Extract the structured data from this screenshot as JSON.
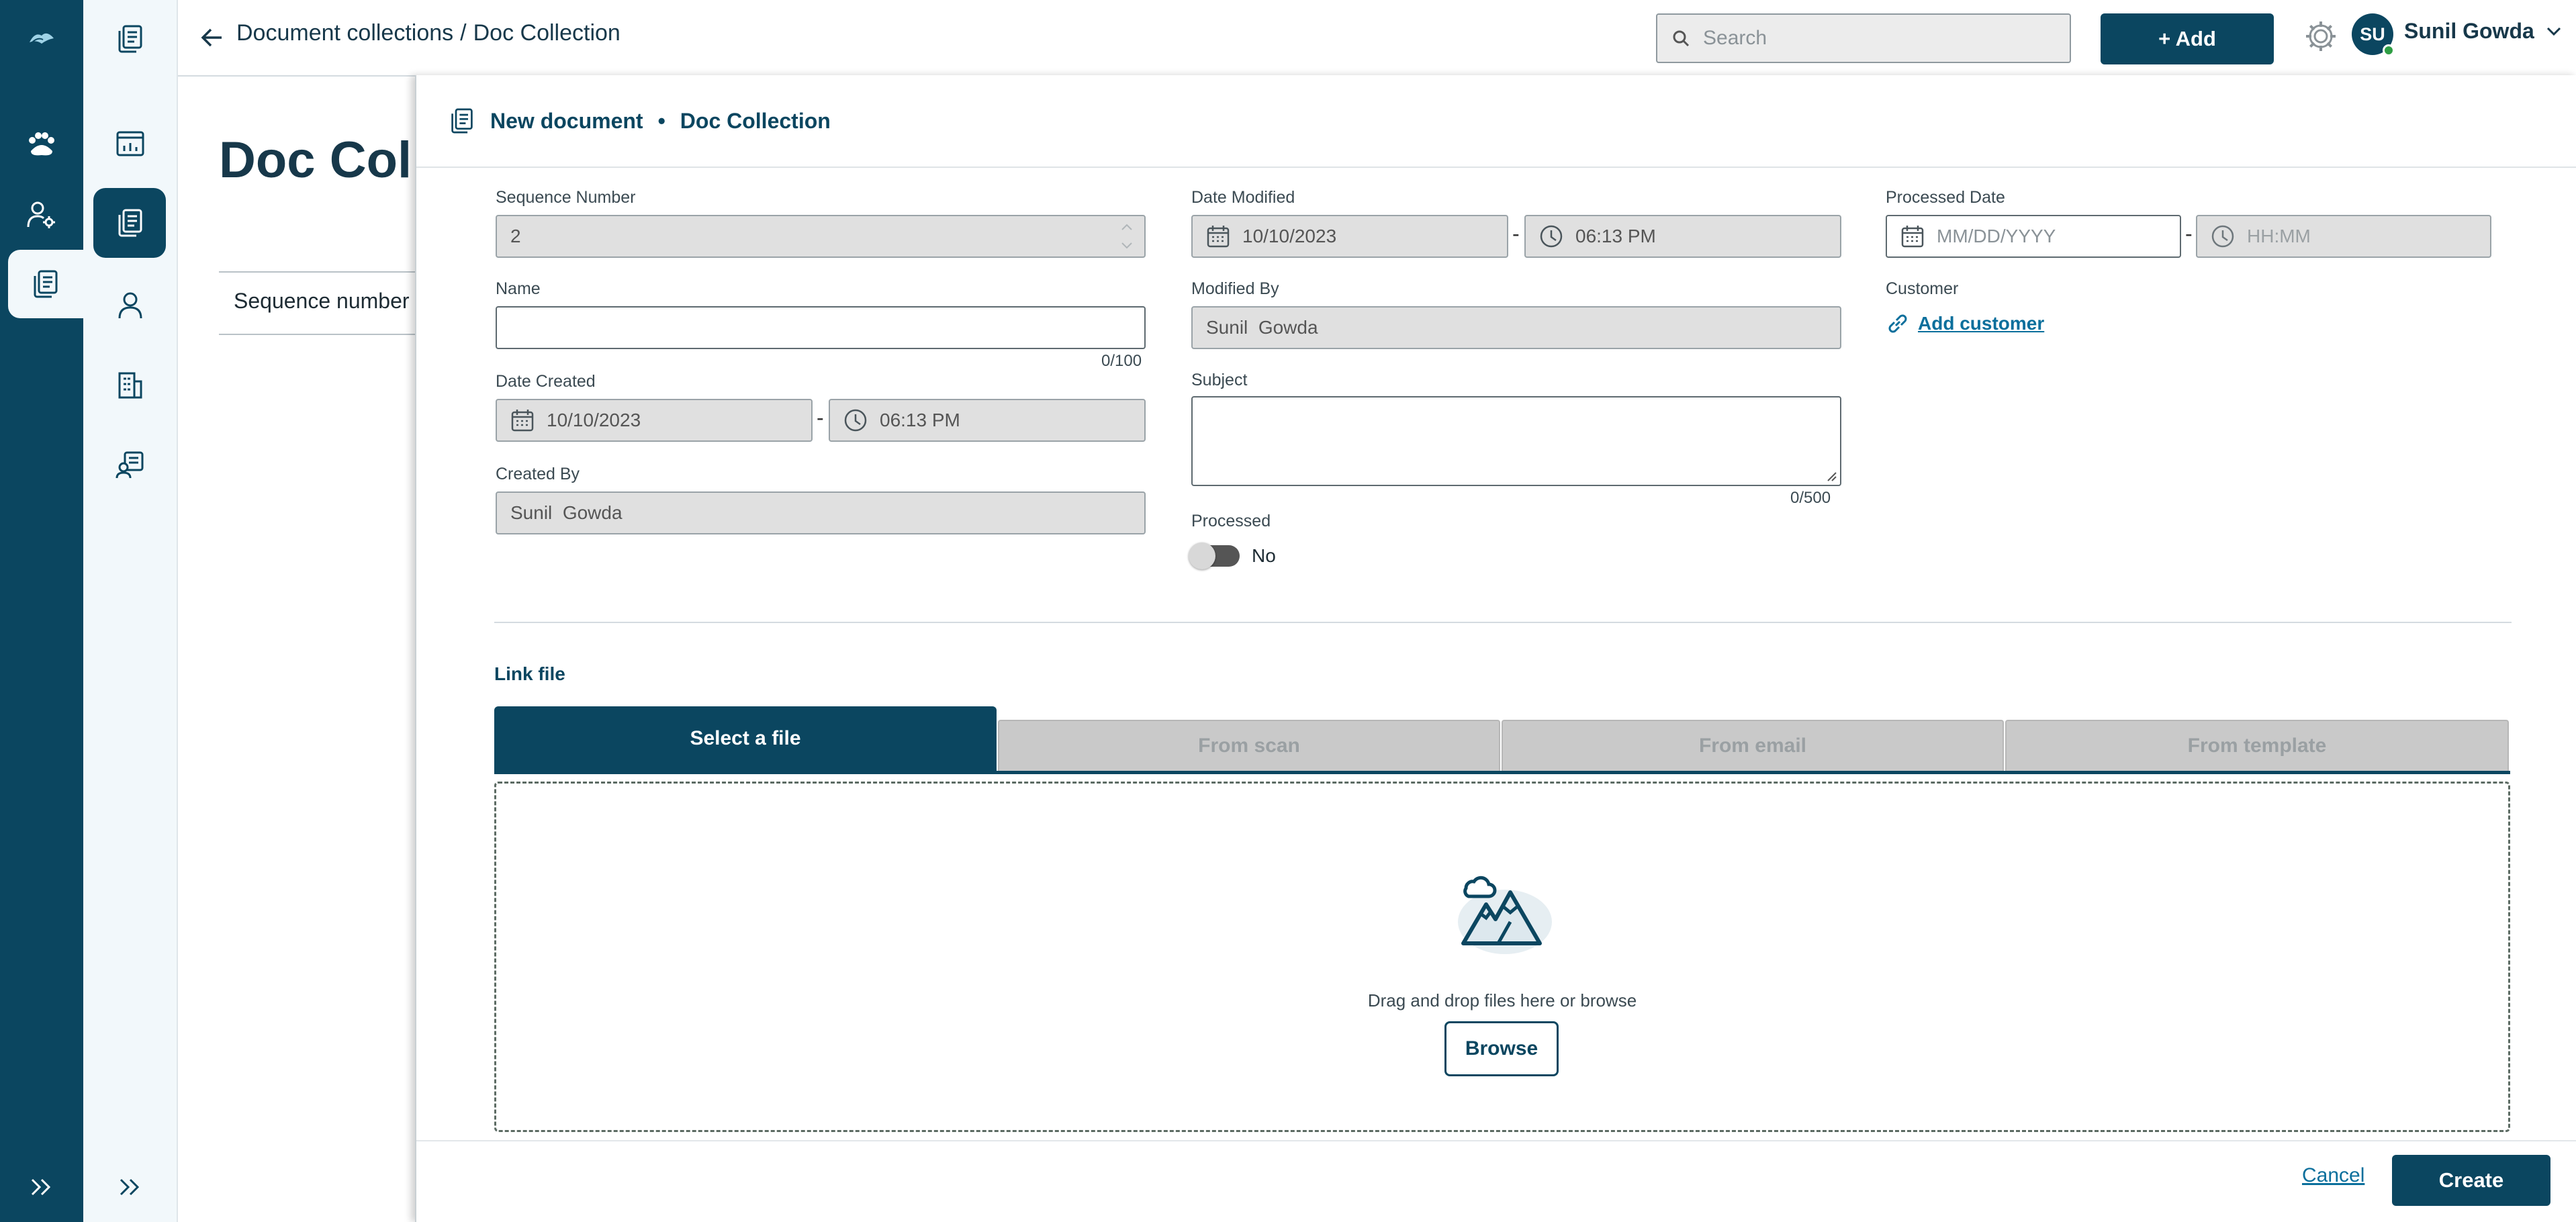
{
  "header": {
    "back_icon": "arrow-left-icon",
    "breadcrumb_parent": "Document collections",
    "breadcrumb_separator": "/",
    "breadcrumb_current": "Doc Collection",
    "search_placeholder": "Search",
    "add_label": "+ Add",
    "settings_icon": "gear-icon",
    "avatar_initials": "SU",
    "user_name": "Sunil Gowda"
  },
  "rail_primary": {
    "icons": [
      "logo-icon",
      "pets-icon",
      "user-settings-icon",
      "documents-icon",
      "expand-icon"
    ],
    "active": "documents-icon"
  },
  "rail_secondary": {
    "icons": [
      "documents-icon",
      "report-icon",
      "document-collection-icon",
      "person-icon",
      "building-icon",
      "contact-card-icon",
      "expand-icon"
    ],
    "active": "document-collection-icon"
  },
  "background_page": {
    "title": "Doc Colle",
    "column_header": "Sequence number"
  },
  "panel": {
    "title": "New document",
    "bullet": "•",
    "subtitle": "Doc Collection",
    "fields": {
      "sequence_number_label": "Sequence Number",
      "sequence_number_value": "2",
      "name_label": "Name",
      "name_value": "",
      "name_counter": "0/100",
      "date_created_label": "Date Created",
      "date_created_date": "10/10/2023",
      "date_created_time": "06:13 PM",
      "created_by_label": "Created By",
      "created_by_value": "Sunil  Gowda",
      "date_modified_label": "Date Modified",
      "date_modified_date": "10/10/2023",
      "date_modified_time": "06:13 PM",
      "modified_by_label": "Modified By",
      "modified_by_value": "Sunil  Gowda",
      "subject_label": "Subject",
      "subject_value": "",
      "subject_counter": "0/500",
      "processed_label": "Processed",
      "processed_value": "No",
      "processed_date_label": "Processed Date",
      "processed_date_placeholder": "MM/DD/YYYY",
      "processed_time_placeholder": "HH:MM",
      "customer_label": "Customer",
      "customer_link": "Add customer",
      "dash": "-"
    },
    "link_file": {
      "title": "Link file",
      "tabs": [
        "Select a file",
        "From scan",
        "From email",
        "From template"
      ],
      "active_tab": "Select a file",
      "drop_text": "Drag and drop files here or browse",
      "browse_label": "Browse",
      "drop_icon": "image-upload-icon"
    },
    "footer": {
      "cancel_label": "Cancel",
      "create_label": "Create"
    }
  },
  "colors": {
    "brand": "#0b4660",
    "rail_bg": "#f2f8fb",
    "disabled_field": "#e0e0e0",
    "link": "#0b6f9c"
  }
}
